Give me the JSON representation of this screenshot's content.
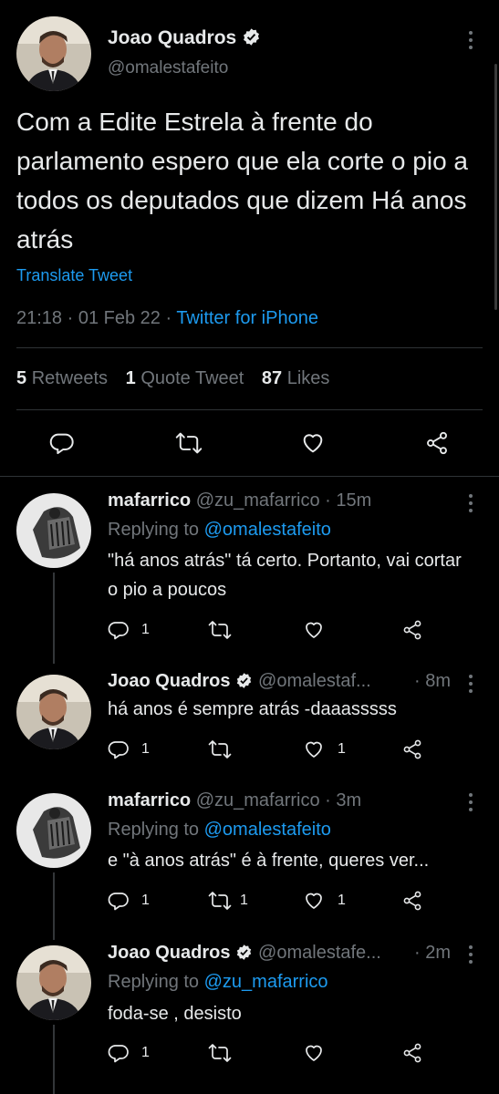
{
  "main_tweet": {
    "author_name": "Joao Quadros",
    "author_handle": "@omalestafeito",
    "text": "Com a Edite Estrela à frente do parlamento espero que ela corte o pio a todos os deputados que dizem Há anos atrás",
    "translate_label": "Translate Tweet",
    "timestamp": "21:18 · 01 Feb 22 · ",
    "source": "Twitter for iPhone",
    "retweets_count": "5",
    "retweets_label": "Retweets",
    "quotes_count": "1",
    "quotes_label": "Quote Tweet",
    "likes_count": "87",
    "likes_label": "Likes"
  },
  "replies": [
    {
      "author_name": "mafarrico",
      "author_meta": "@zu_mafarrico · 15m",
      "replying_prefix": "Replying to ",
      "replying_handle": "@omalestafeito",
      "text": "\"há anos atrás\" tá certo. Portanto, vai cortar o pio a poucos",
      "reply_count": "1",
      "retweet_count": "",
      "like_count": ""
    },
    {
      "author_name": "Joao Quadros",
      "author_handle": "@omalestaf...",
      "time": "· 8m",
      "text": "há anos é sempre atrás -daaasssss",
      "reply_count": "1",
      "retweet_count": "",
      "like_count": "1"
    },
    {
      "author_name": "mafarrico",
      "author_meta": "@zu_mafarrico · 3m",
      "replying_prefix": "Replying to ",
      "replying_handle": "@omalestafeito",
      "text": "e \"à anos atrás\" é à frente, queres ver...",
      "reply_count": "1",
      "retweet_count": "1",
      "like_count": "1"
    },
    {
      "author_name": "Joao Quadros",
      "author_handle": "@omalestafe...",
      "time": "· 2m",
      "replying_prefix": "Replying to ",
      "replying_handle": "@zu_mafarrico",
      "text": "foda-se , desisto",
      "reply_count": "1",
      "retweet_count": "",
      "like_count": ""
    }
  ],
  "icons": {
    "reply": "reply-icon",
    "retweet": "retweet-icon",
    "like": "like-icon",
    "share": "share-icon",
    "more": "more-icon",
    "verified": "verified-badge-icon"
  },
  "colors": {
    "background": "#000000",
    "text": "#e7e9ea",
    "secondary": "#71767b",
    "accent": "#1d9bf0",
    "divider": "#2f3336"
  }
}
